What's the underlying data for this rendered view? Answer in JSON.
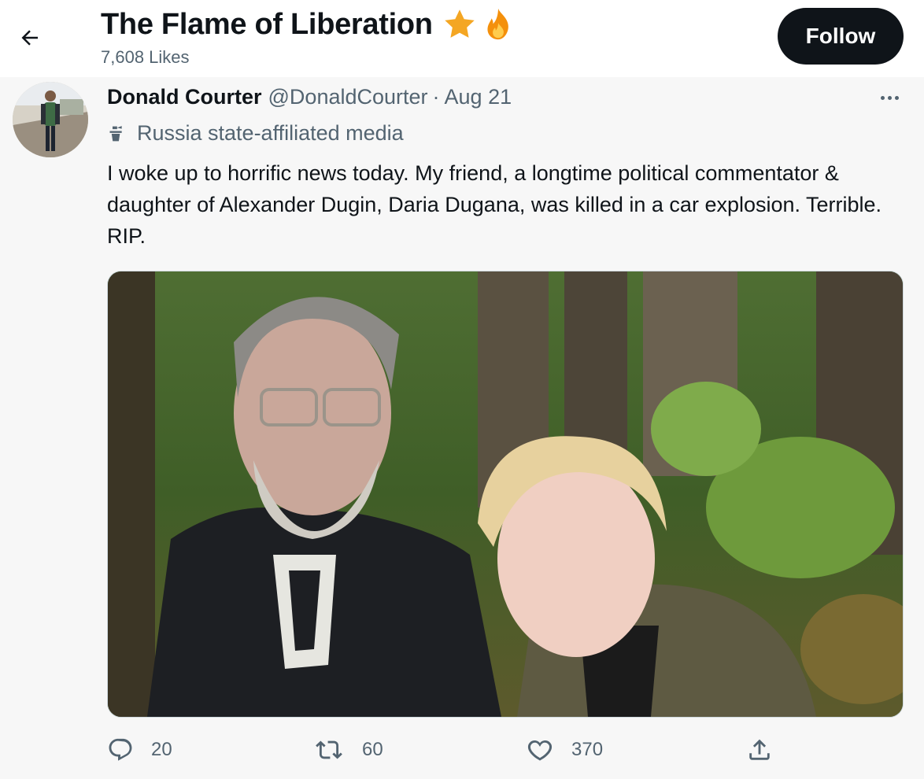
{
  "header": {
    "title": "The Flame of Liberation",
    "likes": "7,608 Likes",
    "follow_label": "Follow",
    "emoji": [
      "star",
      "fire"
    ]
  },
  "tweet": {
    "author_name": "Donald Courter",
    "handle": "@DonaldCourter",
    "separator": "·",
    "date": "Aug 21",
    "label": "Russia state-affiliated media",
    "text": "I woke up to horrific news today. My friend, a longtime political commentator & daughter of Alexander Dugin, Daria Dugana, was killed in a car explosion. Terrible. RIP.",
    "stats": {
      "replies": "20",
      "retweets": "60",
      "likes": "370"
    }
  },
  "icons": {
    "back": "back-arrow-icon",
    "more": "more-dots-icon",
    "label": "podium-icon",
    "reply": "reply-icon",
    "retweet": "retweet-icon",
    "like": "heart-icon",
    "share": "share-icon"
  },
  "colors": {
    "follow_bg": "#0f1419",
    "secondary_text": "#536471"
  }
}
